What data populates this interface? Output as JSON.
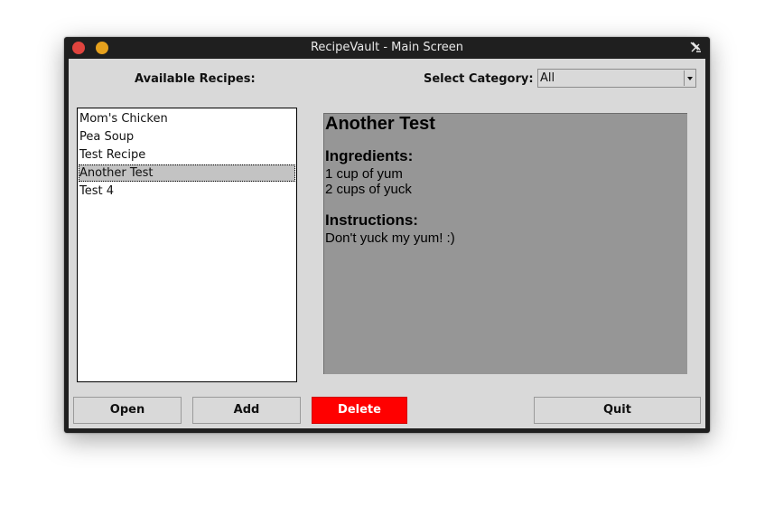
{
  "window": {
    "title": "RecipeVault - Main Screen"
  },
  "recipes": {
    "label": "Available Recipes:",
    "items": [
      "Mom's Chicken",
      "Pea Soup",
      "Test Recipe",
      "Another Test",
      "Test 4"
    ],
    "selected": "Another Test"
  },
  "category": {
    "label": "Select Category:",
    "value": "All"
  },
  "detail": {
    "title": "Another Test",
    "ingredients_heading": "Ingredients:",
    "ingredients": [
      "1 cup of yum",
      "2 cups of yuck"
    ],
    "instructions_heading": "Instructions:",
    "instructions": "Don't yuck my yum! :)"
  },
  "buttons": {
    "open": "Open",
    "add": "Add",
    "delete": "Delete",
    "quit": "Quit"
  },
  "colors": {
    "delete_button": "#ff0000",
    "detail_background": "#969696",
    "window_background": "#d9d9d9"
  }
}
